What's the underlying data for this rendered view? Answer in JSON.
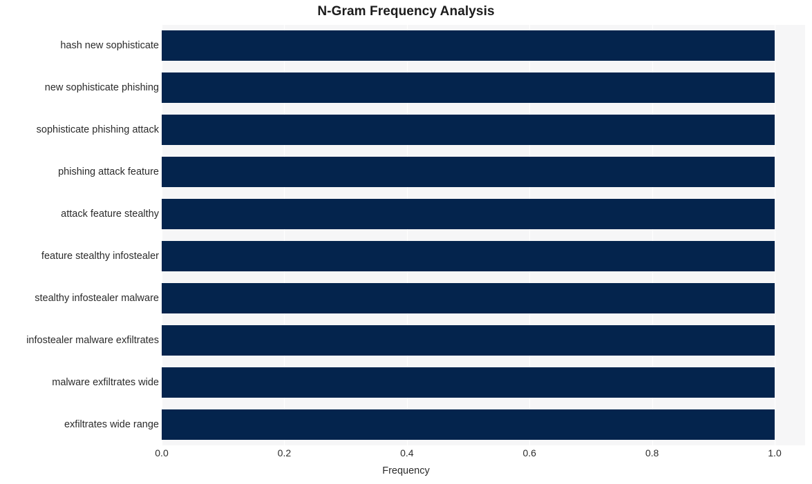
{
  "chart_data": {
    "type": "bar",
    "orientation": "horizontal",
    "title": "N-Gram Frequency Analysis",
    "xlabel": "Frequency",
    "ylabel": "",
    "xlim": [
      0.0,
      1.0
    ],
    "xticks": [
      "0.0",
      "0.2",
      "0.4",
      "0.6",
      "0.8",
      "1.0"
    ],
    "xtick_values": [
      0.0,
      0.2,
      0.4,
      0.6,
      0.8,
      1.0
    ],
    "grid": true,
    "legend": false,
    "legend_position": "none",
    "bar_color": "#04244d",
    "plot_background": "#f6f6f7",
    "page_background": "#ffffff",
    "categories": [
      "hash new sophisticate",
      "new sophisticate phishing",
      "sophisticate phishing attack",
      "phishing attack feature",
      "attack feature stealthy",
      "feature stealthy infostealer",
      "stealthy infostealer malware",
      "infostealer malware exfiltrates",
      "malware exfiltrates wide",
      "exfiltrates wide range"
    ],
    "values": [
      1.0,
      1.0,
      1.0,
      1.0,
      1.0,
      1.0,
      1.0,
      1.0,
      1.0,
      1.0
    ]
  }
}
